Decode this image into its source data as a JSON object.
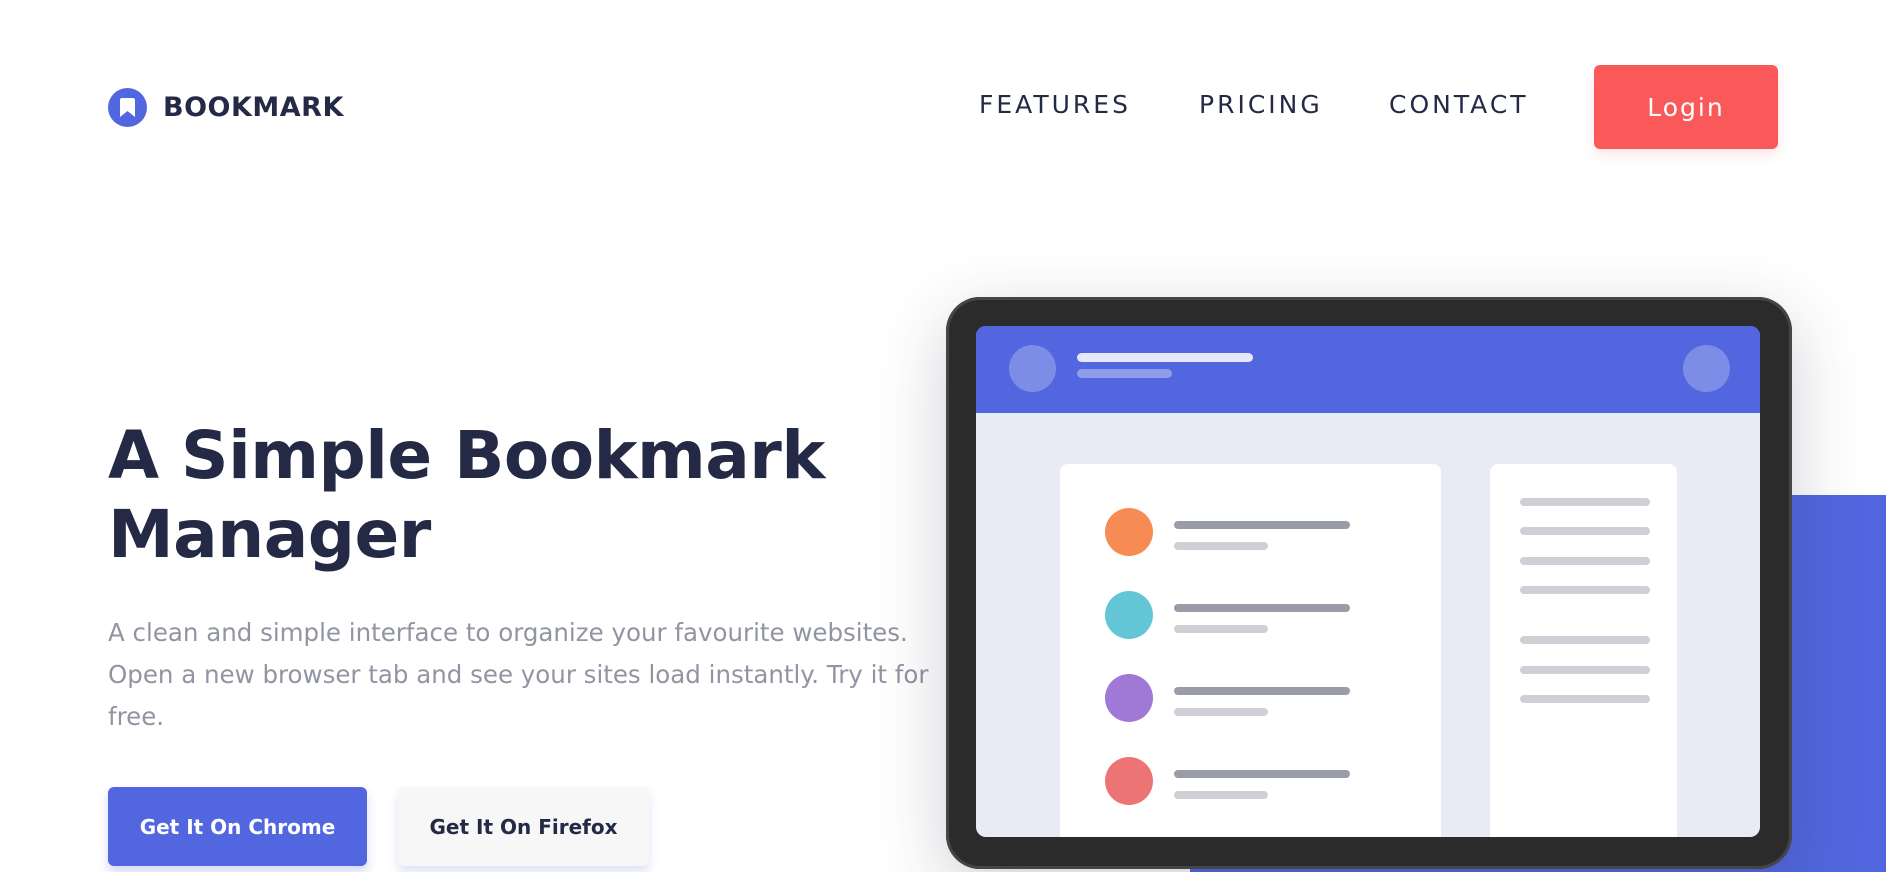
{
  "brand": {
    "name": "BOOKMARK",
    "accent": "#5267DF",
    "secondary": "#FA5959"
  },
  "nav": {
    "items": [
      {
        "label": "FEATURES"
      },
      {
        "label": "PRICING"
      },
      {
        "label": "CONTACT"
      }
    ],
    "login_label": "Login"
  },
  "hero": {
    "title_line1": "A Simple Bookmark",
    "title_line2": "Manager",
    "description": "A clean and simple interface to organize your favourite websites. Open a new browser tab and see your sites load instantly. Try it for free.",
    "buttons": {
      "chrome": "Get It On Chrome",
      "firefox": "Get It On Firefox"
    }
  },
  "illustration": {
    "bookmark_dot_colors": [
      "#F68B54",
      "#62C6D6",
      "#A078D6",
      "#EC7474"
    ]
  }
}
